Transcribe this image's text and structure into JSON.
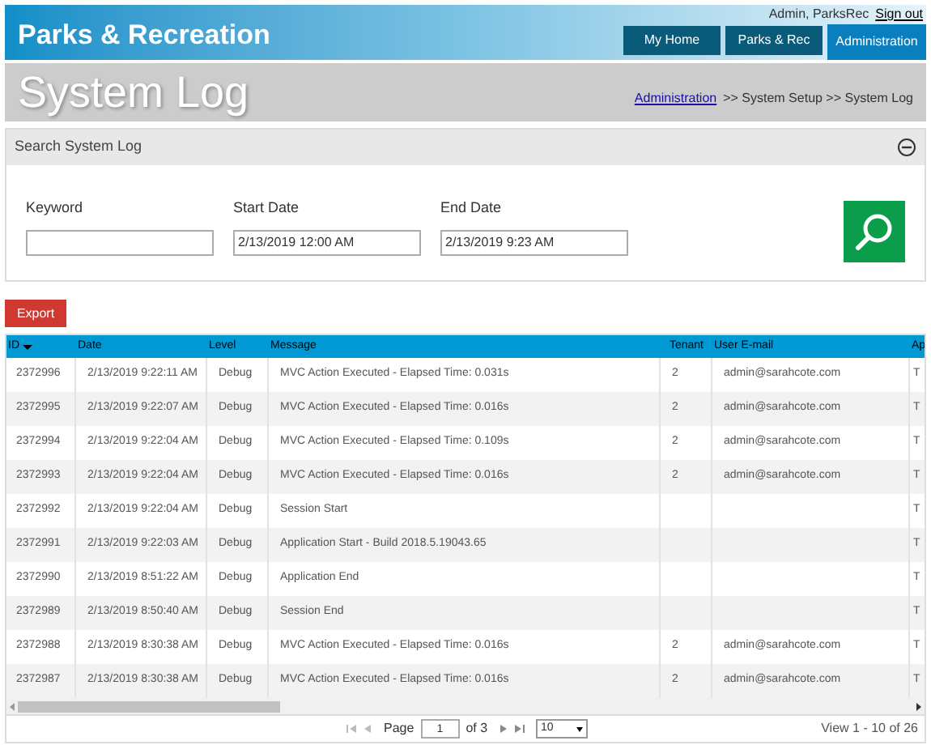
{
  "header": {
    "brand": "Parks & Recreation",
    "user": "Admin, ParksRec",
    "sign_out": "Sign out",
    "tabs": [
      {
        "label": "My Home",
        "selected": false
      },
      {
        "label": "Parks & Rec",
        "selected": false
      },
      {
        "label": "Administration",
        "selected": true
      }
    ]
  },
  "page_title": "System Log",
  "breadcrumb": {
    "link": "Administration",
    "rest": ">> System Setup >> System Log"
  },
  "search": {
    "title": "Search System Log",
    "expanded": true,
    "fields": [
      {
        "label": "Keyword"
      },
      {
        "label": "Start Date",
        "value": "2/13/2019 12:00 AM"
      },
      {
        "label": "End Date",
        "value": "2/13/2019 9:23 AM"
      }
    ]
  },
  "export_button": "Export",
  "table": {
    "columns": [
      {
        "label": "ID",
        "sorted": true
      },
      {
        "label": "Date",
        "sorted": false
      },
      {
        "label": "Level",
        "sorted": false
      },
      {
        "label": "Message",
        "sorted": false
      },
      {
        "label": "Tenant",
        "sorted": false
      },
      {
        "label": "User E-mail",
        "sorted": false
      },
      {
        "label": "Ap",
        "sorted": false
      }
    ],
    "rows": [
      [
        "2372996",
        "2/13/2019 9:22:11 AM",
        "Debug",
        "MVC Action Executed - Elapsed Time: 0.031s",
        "2",
        "admin@sarahcote.com",
        "T"
      ],
      [
        "2372995",
        "2/13/2019 9:22:07 AM",
        "Debug",
        "MVC Action Executed - Elapsed Time: 0.016s",
        "2",
        "admin@sarahcote.com",
        "T"
      ],
      [
        "2372994",
        "2/13/2019 9:22:04 AM",
        "Debug",
        "MVC Action Executed - Elapsed Time: 0.109s",
        "2",
        "admin@sarahcote.com",
        "T"
      ],
      [
        "2372993",
        "2/13/2019 9:22:04 AM",
        "Debug",
        "MVC Action Executed - Elapsed Time: 0.016s",
        "2",
        "admin@sarahcote.com",
        "T"
      ],
      [
        "2372992",
        "2/13/2019 9:22:04 AM",
        "Debug",
        "Session Start",
        "",
        "",
        "T"
      ],
      [
        "2372991",
        "2/13/2019 9:22:03 AM",
        "Debug",
        "Application Start - Build 2018.5.19043.65",
        "",
        "",
        "T"
      ],
      [
        "2372990",
        "2/13/2019 8:51:22 AM",
        "Debug",
        "Application End",
        "",
        "",
        "T"
      ],
      [
        "2372989",
        "2/13/2019 8:50:40 AM",
        "Debug",
        "Session End",
        "",
        "",
        "T"
      ],
      [
        "2372988",
        "2/13/2019 8:30:38 AM",
        "Debug",
        "MVC Action Executed - Elapsed Time: 0.016s",
        "2",
        "admin@sarahcote.com",
        "T"
      ],
      [
        "2372987",
        "2/13/2019 8:30:38 AM",
        "Debug",
        "MVC Action Executed - Elapsed Time: 0.016s",
        "2",
        "admin@sarahcote.com",
        "T"
      ]
    ]
  },
  "pager": {
    "page_label": "Page",
    "page": "1",
    "of": "of 3",
    "page_size": "10",
    "summary": "View 1 - 10 of 26"
  }
}
